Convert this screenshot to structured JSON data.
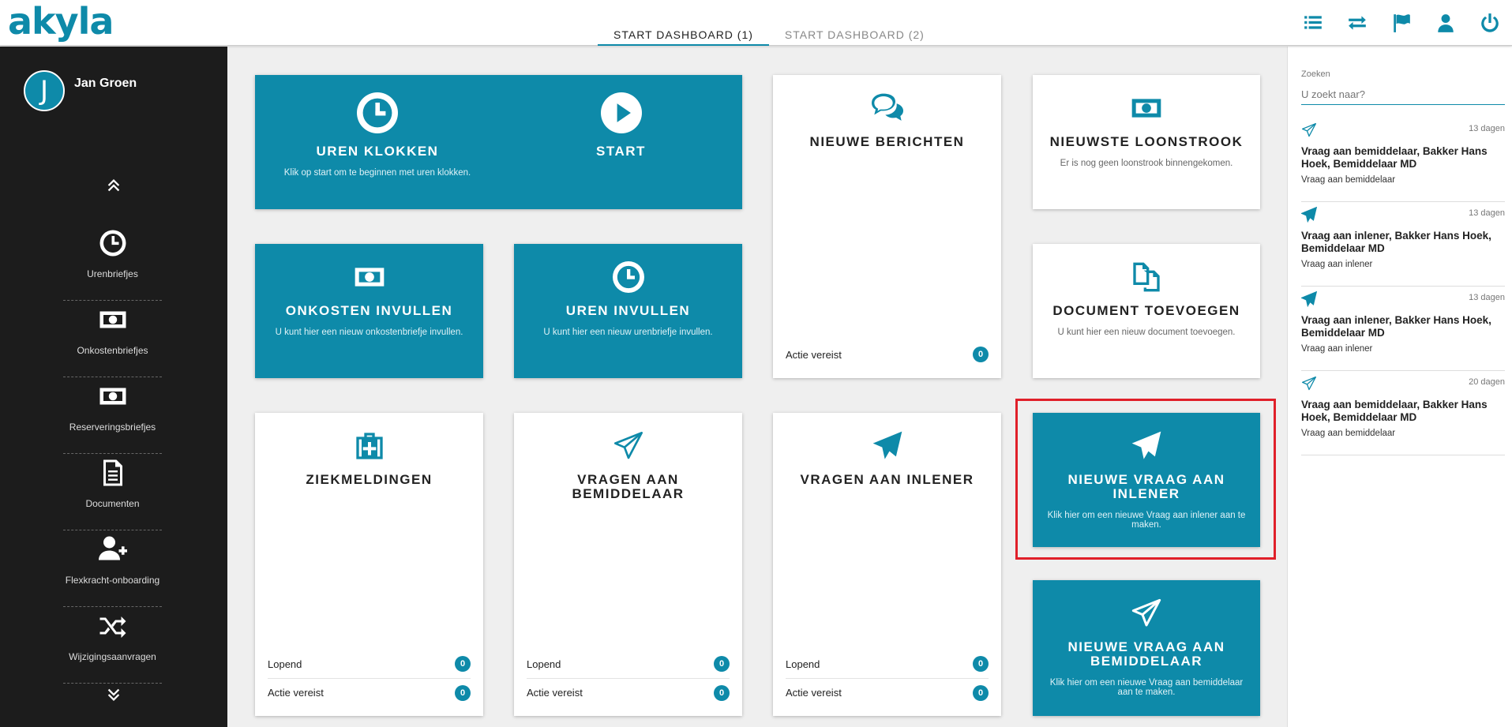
{
  "app": {
    "logo": "akyla"
  },
  "tabs": [
    {
      "label": "START DASHBOARD (1)"
    },
    {
      "label": "START DASHBOARD (2)"
    }
  ],
  "header_icons": [
    "list-icon",
    "swap-icon",
    "flag-icon",
    "user-icon",
    "power-icon"
  ],
  "user": {
    "initial": "J",
    "name": "Jan Groen"
  },
  "sidebar": {
    "items": [
      {
        "label": "Urenbriefjes",
        "icon": "clock-icon"
      },
      {
        "label": "Onkostenbriefjes",
        "icon": "money-icon"
      },
      {
        "label": "Reserveringsbriefjes",
        "icon": "money-icon"
      },
      {
        "label": "Documenten",
        "icon": "document-icon"
      },
      {
        "label": "Flexkracht-onboarding",
        "icon": "user-add-icon"
      },
      {
        "label": "Wijzigingsaanvragen",
        "icon": "shuffle-icon"
      }
    ]
  },
  "tiles": {
    "uren_klokken": {
      "title": "UREN KLOKKEN",
      "sub": "Klik op start om te beginnen met uren klokken.",
      "start": "START"
    },
    "onkosten": {
      "title": "ONKOSTEN INVULLEN",
      "sub": "U kunt hier een nieuw onkostenbriefje invullen."
    },
    "uren_invullen": {
      "title": "UREN INVULLEN",
      "sub": "U kunt hier een nieuw urenbriefje invullen."
    },
    "berichten": {
      "title": "NIEUWE BERICHTEN",
      "row_label": "Actie vereist",
      "row_count": "0"
    },
    "loonstrook": {
      "title": "NIEUWSTE LOONSTROOK",
      "sub": "Er is nog geen loonstrook binnengekomen."
    },
    "document": {
      "title": "DOCUMENT TOEVOEGEN",
      "sub": "U kunt hier een nieuw document toevoegen."
    },
    "ziekmeldingen": {
      "title": "ZIEKMELDINGEN",
      "r1_label": "Lopend",
      "r1_count": "0",
      "r2_label": "Actie vereist",
      "r2_count": "0"
    },
    "vragen_bemiddelaar": {
      "title": "VRAGEN AAN BEMIDDELAAR",
      "r1_label": "Lopend",
      "r1_count": "0",
      "r2_label": "Actie vereist",
      "r2_count": "0"
    },
    "vragen_inlener": {
      "title": "VRAGEN AAN INLENER",
      "r1_label": "Lopend",
      "r1_count": "0",
      "r2_label": "Actie vereist",
      "r2_count": "0"
    },
    "nieuwe_vraag_inlener": {
      "title": "NIEUWE VRAAG AAN INLENER",
      "sub": "Klik hier om een nieuwe Vraag aan inlener aan te maken."
    },
    "nieuwe_vraag_bemiddelaar": {
      "title": "NIEUWE VRAAG AAN BEMIDDELAAR",
      "sub": "Klik hier om een nieuwe Vraag aan bemiddelaar aan te maken."
    }
  },
  "search": {
    "label": "Zoeken",
    "placeholder": "U zoekt naar?"
  },
  "messages": [
    {
      "date": "13 dagen",
      "title": "Vraag aan bemiddelaar, Bakker Hans Hoek, Bemiddelaar MD",
      "body": "Vraag aan bemiddelaar",
      "icon": "paper-plane-outline-icon"
    },
    {
      "date": "13 dagen",
      "title": "Vraag aan inlener, Bakker Hans Hoek, Bemiddelaar MD",
      "body": "Vraag aan inlener",
      "icon": "paper-plane-icon"
    },
    {
      "date": "13 dagen",
      "title": "Vraag aan inlener, Bakker Hans Hoek, Bemiddelaar MD",
      "body": "Vraag aan inlener",
      "icon": "paper-plane-icon"
    },
    {
      "date": "20 dagen",
      "title": "Vraag aan bemiddelaar, Bakker Hans Hoek, Bemiddelaar MD",
      "body": "Vraag aan bemiddelaar",
      "icon": "paper-plane-outline-icon"
    }
  ],
  "colors": {
    "accent": "#0e8aa9",
    "sidebar": "#1c1c1c",
    "highlight": "#e0202a"
  }
}
